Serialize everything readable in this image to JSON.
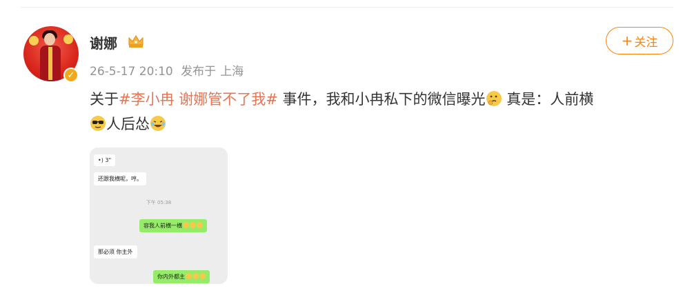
{
  "post": {
    "author": "谢娜",
    "timestamp": "26-5-17 20:10",
    "posted_via": "发布于",
    "location": "上海",
    "follow_label": "关注",
    "follow_plus": "+",
    "text_before_topic": "关于",
    "topic": "#李小冉 谢娜管不了我#",
    "text_after_topic": " 事件，我和小冉私下的微信曝光",
    "text_middle": "  真是：人前横",
    "text_end": "人后怂"
  },
  "chat": {
    "voice_label": "3\"",
    "msg1": "还跟我横呢，哼。",
    "time": "下午 05:38",
    "msg2": "容我人前横一横",
    "msg3": "那必须 你主外",
    "msg4": "你内外都主"
  },
  "icons": {
    "verified": "verified-badge-icon",
    "level": "crown-level-icon",
    "emoji_thinking": "thinking-emoji",
    "emoji_cool": "sunglasses-emoji",
    "emoji_laugh": "laughing-tears-emoji"
  },
  "colors": {
    "accent": "#ff8200",
    "topic": "#eb7350",
    "text": "#333333",
    "meta": "#939393"
  }
}
